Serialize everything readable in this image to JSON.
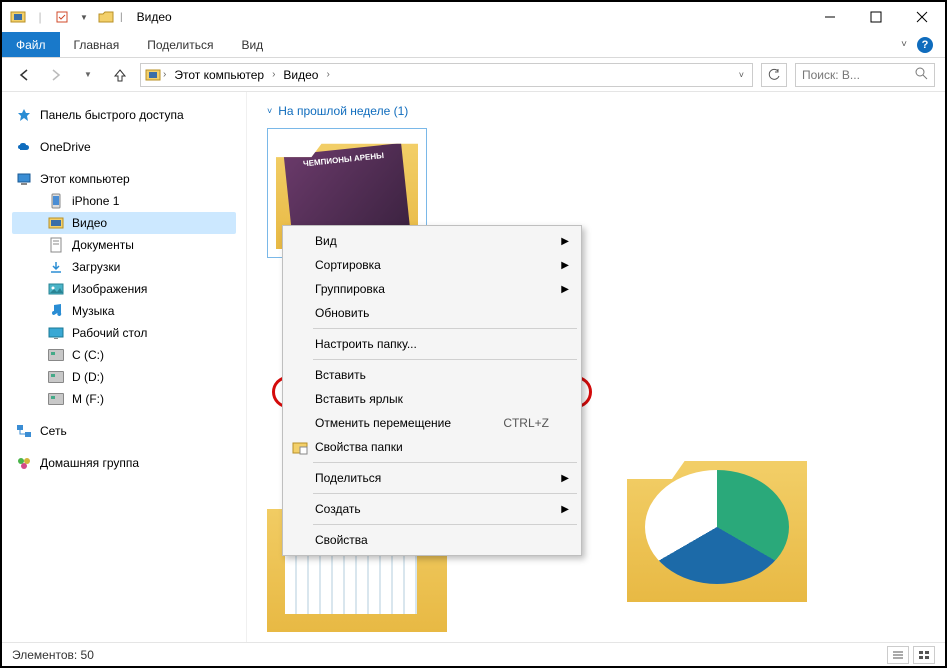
{
  "titlebar": {
    "title": "Видео"
  },
  "ribbon": {
    "file": "Файл",
    "home": "Главная",
    "share": "Поделиться",
    "view": "Вид"
  },
  "breadcrumb": {
    "root": "Этот компьютер",
    "current": "Видео"
  },
  "search": {
    "placeholder": "Поиск: В..."
  },
  "sidebar": {
    "quick_access": "Панель быстрого доступа",
    "onedrive": "OneDrive",
    "this_pc": "Этот компьютер",
    "iphone": "iPhone 1",
    "videos": "Видео",
    "documents": "Документы",
    "downloads": "Загрузки",
    "pictures": "Изображения",
    "music": "Музыка",
    "desktop": "Рабочий стол",
    "drive_c": "C (C:)",
    "drive_d": "D (D:)",
    "drive_m": "M (F:)",
    "network": "Сеть",
    "homegroup": "Домашняя группа"
  },
  "content": {
    "group_header": "На прошлой неделе (1)",
    "thumb_text": "ЧЕМПИОНЫ АРЕНЫ"
  },
  "context_menu": {
    "view": "Вид",
    "sort": "Сортировка",
    "group": "Группировка",
    "refresh": "Обновить",
    "customize": "Настроить папку...",
    "paste": "Вставить",
    "paste_shortcut": "Вставить ярлык",
    "undo_move": "Отменить перемещение",
    "undo_shortcut": "CTRL+Z",
    "folder_props": "Свойства папки",
    "share": "Поделиться",
    "new": "Создать",
    "properties": "Свойства"
  },
  "statusbar": {
    "count_label": "Элементов: 50"
  }
}
